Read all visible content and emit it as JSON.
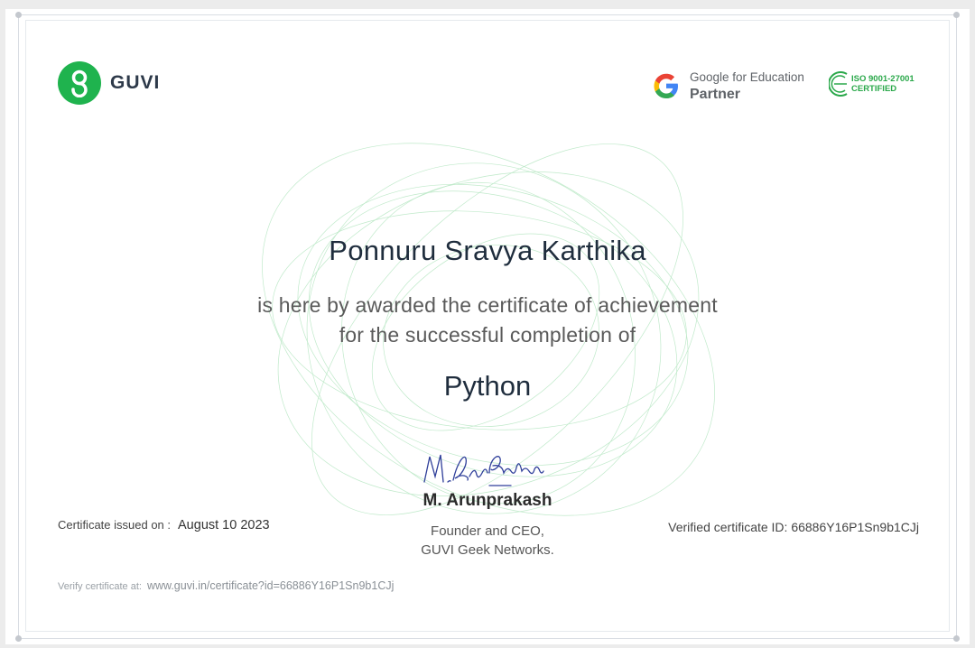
{
  "brand": {
    "logo_text": "GUVI",
    "logo_color": "#1fb34e"
  },
  "partner": {
    "line1": "Google for Education",
    "line2": "Partner"
  },
  "iso": {
    "line1": "ISO 9001-27001",
    "line2": "CERTIFIED"
  },
  "certificate": {
    "recipient_name": "Ponnuru Sravya Karthika",
    "award_line1": "is here by awarded the certificate of achievement",
    "award_line2": "for the successful completion of",
    "course": "Python",
    "signature_text": "M. Arunprakash",
    "signer_name": "M. Arunprakash",
    "signer_title_line1": "Founder and CEO,",
    "signer_title_line2": "GUVI Geek Networks.",
    "issued_label": "Certificate issued on :",
    "issued_date": "August 10 2023",
    "verified_id_text": "Verified certificate ID: 66886Y16P1Sn9b1CJj",
    "verify_label": "Verify certificate at:",
    "verify_url": "www.guvi.in/certificate?id=66886Y16P1Sn9b1CJj"
  },
  "colors": {
    "accent_green": "#1fb34e",
    "text_dark": "#1f2d3d",
    "watermark": "#4cc36a"
  }
}
